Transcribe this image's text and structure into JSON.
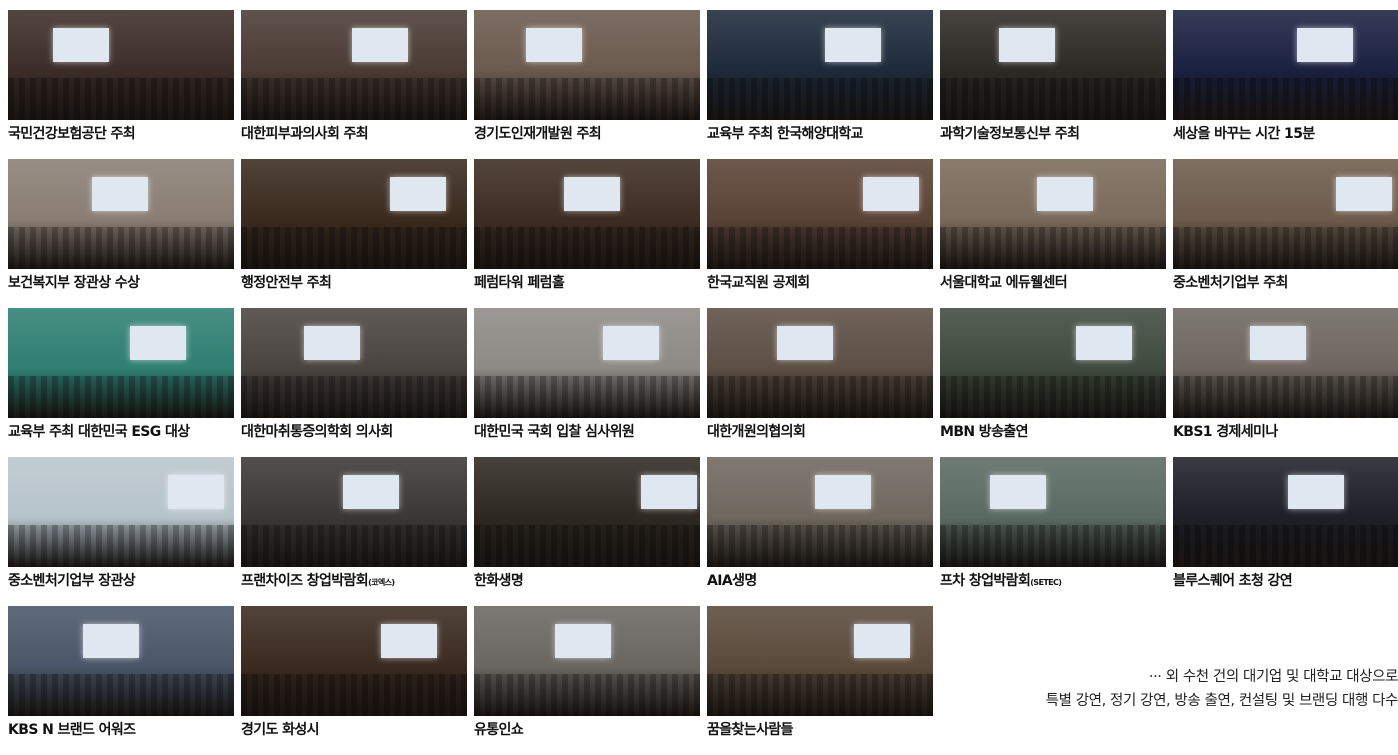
{
  "rows": [
    [
      {
        "caption": "국민건강보험공단 주최",
        "photo": "speaker-podium-photo",
        "tone": "#3c2d28"
      },
      {
        "caption": "대한피부과의사회 주최",
        "photo": "conference-hall-photo",
        "tone": "#4a3b34"
      },
      {
        "caption": "경기도인재개발원 주최",
        "photo": "conference-hall-photo",
        "tone": "#6b5a4e"
      },
      {
        "caption": "교육부 주최 한국해양대학교",
        "photo": "stage-screen-photo",
        "tone": "#1d2a3a"
      },
      {
        "caption": "과학기술정보통신부 주최",
        "photo": "stage-screen-photo",
        "tone": "#2d2a26"
      },
      {
        "caption": "세상을 바꾸는 시간 15분",
        "photo": "tv-stage-photo",
        "tone": "#1a2140"
      }
    ],
    [
      {
        "caption": "보건복지부 장관상 수상",
        "photo": "award-ceremony-photo",
        "tone": "#8a7e74"
      },
      {
        "caption": "행정안전부 주최",
        "photo": "auditorium-photo",
        "tone": "#3a2a1e"
      },
      {
        "caption": "페럼타워 페럼홀",
        "photo": "auditorium-photo",
        "tone": "#3d2c22"
      },
      {
        "caption": "한국교직원 공제회",
        "photo": "speaker-photo",
        "tone": "#5a4236"
      },
      {
        "caption": "서울대학교 에듀웰센터",
        "photo": "seminar-room-photo",
        "tone": "#7a6a5a"
      },
      {
        "caption": "중소벤처기업부  주최",
        "photo": "seminar-room-photo",
        "tone": "#6c5b4b"
      }
    ],
    [
      {
        "caption": "교육부 주최 대한민국 ESG 대상",
        "photo": "award-ceremony-photo",
        "tone": "#2f7f72"
      },
      {
        "caption": "대한마취통증의학회 의사회",
        "photo": "speaker-screen-photo",
        "tone": "#4a4440"
      },
      {
        "caption": "대한민국 국회 입찰 심사위원",
        "photo": "meeting-room-photo",
        "tone": "#8d8a86"
      },
      {
        "caption": "대한개원의협의회",
        "photo": "conference-hall-photo",
        "tone": "#5c4f44"
      },
      {
        "caption": "MBN 방송출연",
        "photo": "tv-studio-photo",
        "tone": "#3f4a3e"
      },
      {
        "caption": "KBS1 경제세미나",
        "photo": "tv-studio-photo",
        "tone": "#6d6760"
      }
    ],
    [
      {
        "caption": "중소벤처기업부 장관상",
        "photo": "award-ceremony-photo",
        "tone": "#b8c4cc"
      },
      {
        "caption": "프랜차이즈 창업박람회",
        "caption_small": "(코엑스)",
        "photo": "expo-hall-photo",
        "tone": "#3a3836"
      },
      {
        "caption": "한화생명",
        "photo": "banquet-hall-photo",
        "tone": "#2e2822"
      },
      {
        "caption": "AIA생명",
        "photo": "banquet-hall-photo",
        "tone": "#6e675e"
      },
      {
        "caption": "프차 창업박람회",
        "caption_small": "(SETEC)",
        "photo": "expo-hall-photo",
        "tone": "#5a6a62"
      },
      {
        "caption": "블루스퀘어 초청 강연",
        "photo": "theater-photo",
        "tone": "#1e1f28"
      }
    ],
    [
      {
        "caption": "KBS N 브랜드 어워즈",
        "photo": "award-ceremony-photo",
        "tone": "#4a5668"
      },
      {
        "caption": "경기도 화성시",
        "photo": "theater-photo",
        "tone": "#3a2a20"
      },
      {
        "caption": "유통인쇼",
        "photo": "expo-hall-photo",
        "tone": "#6a6662"
      },
      {
        "caption": "꿈을찾는사람들",
        "photo": "seminar-room-photo",
        "tone": "#5a4a3c"
      }
    ]
  ],
  "note": {
    "line1": "··· 외 수천 건의 대기업 및 대학교 대상으로",
    "line2": "특별 강연, 정기 강연, 방송 출연, 컨설팅 및 브랜딩 대행 다수"
  }
}
